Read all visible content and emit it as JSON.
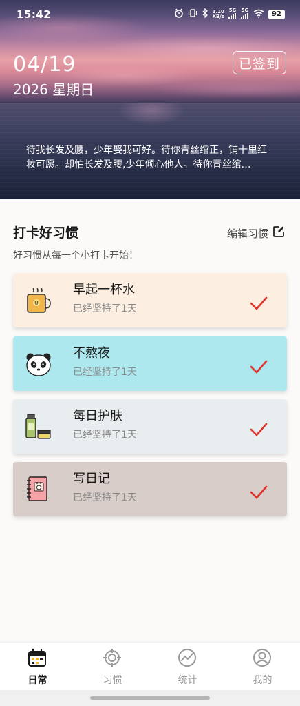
{
  "status_bar": {
    "time": "15:42",
    "net_speed_value": "1.10",
    "net_speed_unit": "KB/s",
    "sim1": "5G",
    "sim2": "5G",
    "battery": "92"
  },
  "header": {
    "date": "04/19",
    "year_weekday": "2026 星期日",
    "signed_label": "已签到",
    "quote": "待我长发及腰，少年娶我可好。待你青丝绾正，铺十里红妆可愿。却怕长发及腰,少年倾心他人。待你青丝绾…"
  },
  "section": {
    "title": "打卡好习惯",
    "edit_label": "编辑习惯",
    "subtitle": "好习惯从每一个小打卡开始！"
  },
  "habits": [
    {
      "name": "早起一杯水",
      "days": "已经坚持了1天",
      "icon": "water-cup-icon",
      "bg": "#fdeee2",
      "checked": true
    },
    {
      "name": "不熬夜",
      "days": "已经坚持了1天",
      "icon": "panda-icon",
      "bg": "#ade8ef",
      "checked": true
    },
    {
      "name": "每日护肤",
      "days": "已经坚持了1天",
      "icon": "skincare-icon",
      "bg": "#e8edf0",
      "checked": true
    },
    {
      "name": "写日记",
      "days": "已经坚持了1天",
      "icon": "diary-icon",
      "bg": "#d8cdc8",
      "checked": true
    }
  ],
  "nav": [
    {
      "label": "日常",
      "icon": "calendar-icon",
      "active": true
    },
    {
      "label": "习惯",
      "icon": "target-icon",
      "active": false
    },
    {
      "label": "统计",
      "icon": "chart-icon",
      "active": false
    },
    {
      "label": "我的",
      "icon": "user-icon",
      "active": false
    }
  ],
  "colors": {
    "check": "#e0312b",
    "active_nav": "#1a1a1a",
    "inactive_nav": "#9a9a9a"
  }
}
